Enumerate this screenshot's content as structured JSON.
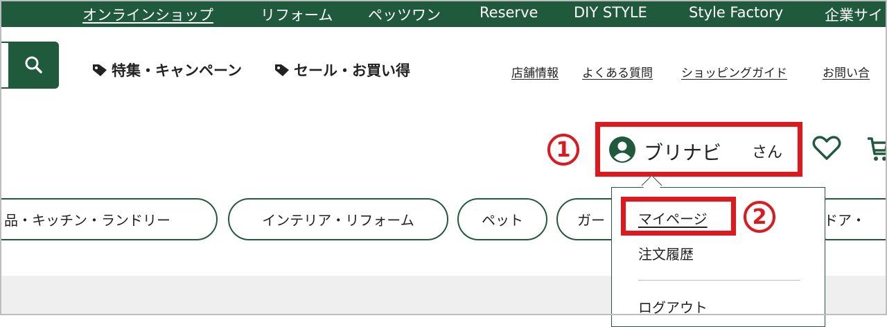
{
  "top_nav": {
    "items": [
      "オンラインショップ",
      "リフォーム",
      "ペッツワン",
      "Reserve",
      "DIY STYLE",
      "Style Factory",
      "企業サイ"
    ]
  },
  "search": {
    "icon": "search-icon"
  },
  "promos": [
    "特集・キャンペーン",
    "セール・お買い得"
  ],
  "utility_links": [
    "店舗情報",
    "よくある質問",
    "ショッピングガイド",
    "お問い合"
  ],
  "account": {
    "user_name": "ブリナビ",
    "suffix": "さん",
    "wishlist_icon": "heart-icon",
    "cart_icon": "cart-icon"
  },
  "annotations": [
    "1",
    "2"
  ],
  "categories": [
    "品・キッチン・ランドリー",
    "インテリア・リフォーム",
    "ペット",
    "ガー",
    "ドア・"
  ],
  "user_menu": {
    "items": [
      "マイページ",
      "注文履歴",
      "ログアウト"
    ]
  },
  "colors": {
    "brand_green": "#1f5a3c",
    "annotation_red": "#e3161b"
  }
}
